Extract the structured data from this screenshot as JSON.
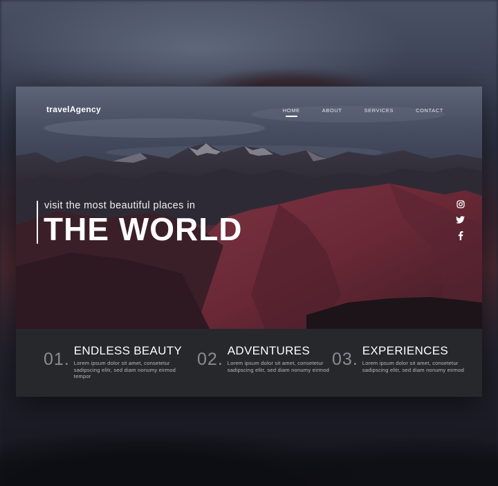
{
  "brand": {
    "name": "travelAgency"
  },
  "nav": {
    "items": [
      {
        "label": "HOME",
        "active": true
      },
      {
        "label": "ABOUT",
        "active": false
      },
      {
        "label": "SERVICES",
        "active": false
      },
      {
        "label": "CONTACT",
        "active": false
      }
    ]
  },
  "hero": {
    "subtitle": "visit the most beautiful places in",
    "title": "THE WORLD"
  },
  "socials": [
    "instagram-icon",
    "twitter-icon",
    "facebook-icon"
  ],
  "features": [
    {
      "number": "01",
      "title": "ENDLESS BEAUTY",
      "desc": "Lorem ipsum dolor sit amet, consetetur sadipscing elitr, sed diam nonumy eirmod tempor"
    },
    {
      "number": "02",
      "title": "ADVENTURES",
      "desc": "Lorem ipsum dolor sit amet, consetetur sadipscing elitr, sed diam nonumy eirmod"
    },
    {
      "number": "03",
      "title": "EXPERIENCES",
      "desc": "Lorem ipsum dolor sit amet, consetetur sadipscing elitr, sed diam nonumy eirmod"
    }
  ],
  "colors": {
    "accent": "#ffffff",
    "features_bg": "#27282c",
    "number_gray": "#8a8c94"
  }
}
